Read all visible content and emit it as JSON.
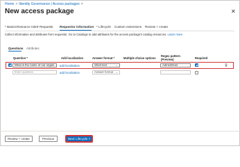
{
  "breadcrumb": {
    "home": "Home",
    "separator": ">",
    "section": "Identity Governance | Access packages"
  },
  "page": {
    "title": "New access package",
    "close_icon": "close-icon"
  },
  "wizard_tabs": [
    "* Basics",
    "Resource roles",
    "* Requests",
    "Requestor information",
    "* Lifecycle",
    "Custom extensions",
    "Review + create"
  ],
  "active_tab": "Requestor information",
  "description": {
    "text": "Collect information and attributes from requestor. Go to Catalogs to add attributes for the access package's catalog resources.",
    "link": "Learn more."
  },
  "subtabs": {
    "questions": "Questions",
    "attributes": "Attributes"
  },
  "table": {
    "headers": {
      "question": "Question *",
      "localization": "Add localization",
      "answer_format": "Answer format *",
      "multiple_choice": "Multiple choice options",
      "regex_line1": "Regex pattern",
      "regex_line2": "(Preview)",
      "required": "Required"
    },
    "rows": [
      {
        "selected": true,
        "question": "What is the name of our organi…",
        "localization": "add localization",
        "answer_format": "Short text",
        "regex": "AdminDroid",
        "required": true
      },
      {
        "selected": false,
        "question": "Enter question",
        "localization": "add localization",
        "answer_format": "Answer format",
        "regex": "",
        "required": false
      }
    ]
  },
  "footer": {
    "review": "Review + create",
    "previous": "Previous",
    "next": "Next: Lifecycle >"
  },
  "colors": {
    "accent": "#0f6cbd",
    "highlight": "#d13438"
  }
}
